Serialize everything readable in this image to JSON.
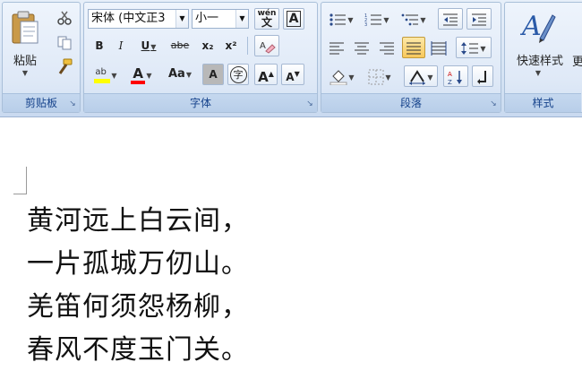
{
  "clipboard": {
    "label": "剪贴板",
    "paste_label": "粘贴",
    "icons": [
      "paste-icon",
      "cut-icon",
      "copy-icon",
      "format-painter-icon"
    ]
  },
  "font": {
    "label": "字体",
    "font_name": "宋体 (中文正3",
    "font_size": "小一",
    "buttons": {
      "bold": "B",
      "italic": "I",
      "underline": "U",
      "strikethrough": "abe",
      "subscript": "x₂",
      "superscript": "x²",
      "change_case": "Aa",
      "char_shading": "A",
      "enclose": "字",
      "grow": "A",
      "shrink": "A",
      "clear_format": "A",
      "phonetic": "wén",
      "char_border": "A",
      "highlight": "ab",
      "font_color": "A"
    },
    "highlight_color": "#ffff00",
    "font_color": "#ff0000"
  },
  "paragraph": {
    "label": "段落"
  },
  "styles": {
    "label": "样式",
    "quick_styles_label": "快速样式",
    "change_styles_label": "更"
  },
  "document": {
    "lines": [
      "黄河远上白云间，",
      "一片孤城万仞山。",
      "羌笛何须怨杨柳，",
      "春风不度玉门关。"
    ]
  }
}
